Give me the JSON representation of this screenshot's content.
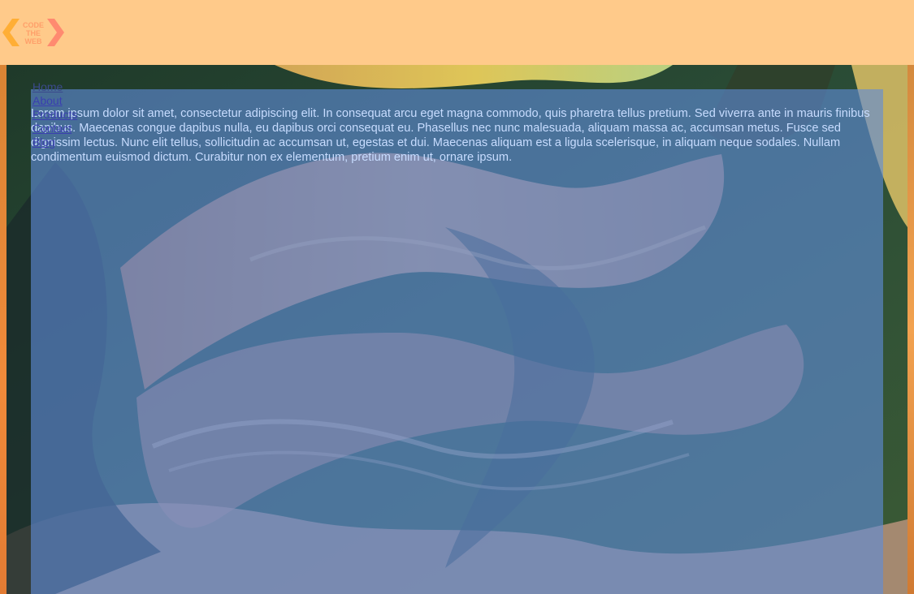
{
  "header": {
    "logo": {
      "lines": [
        "CODE",
        "THE",
        "WEB"
      ],
      "icon": "code-the-web-logo"
    }
  },
  "nav": {
    "items": [
      {
        "label": "Home"
      },
      {
        "label": "About"
      },
      {
        "label": "Products"
      },
      {
        "label": "Contact"
      },
      {
        "label": "Blog"
      }
    ]
  },
  "main": {
    "paragraph": "Lorem ipsum dolor sit amet, consectetur adipiscing elit. In consequat arcu eget magna commodo, quis pharetra tellus pretium. Sed viverra ante in mauris finibus dapibus. Maecenas congue dapibus nulla, eu dapibus orci consequat eu. Phasellus nec nunc malesuada, aliquam massa ac, accumsan metus. Fusce sed dignissim lectus. Nunc elit tellus, sollicitudin ac accumsan ut, egestas et dui. Maecenas aliquam est a ligula scelerisque, in aliquam neque sodales. Nullam condimentum euismod dictum. Curabitur non ex elementum, pretium enim ut, ornare ipsum."
  },
  "colors": {
    "header_bg": "#ffca8a",
    "logo_orange": "#ffae35",
    "logo_pink": "#ff8a70",
    "panel_overlay": "#608cda",
    "text": "#c7dcff",
    "link": "#3a3fb0"
  }
}
